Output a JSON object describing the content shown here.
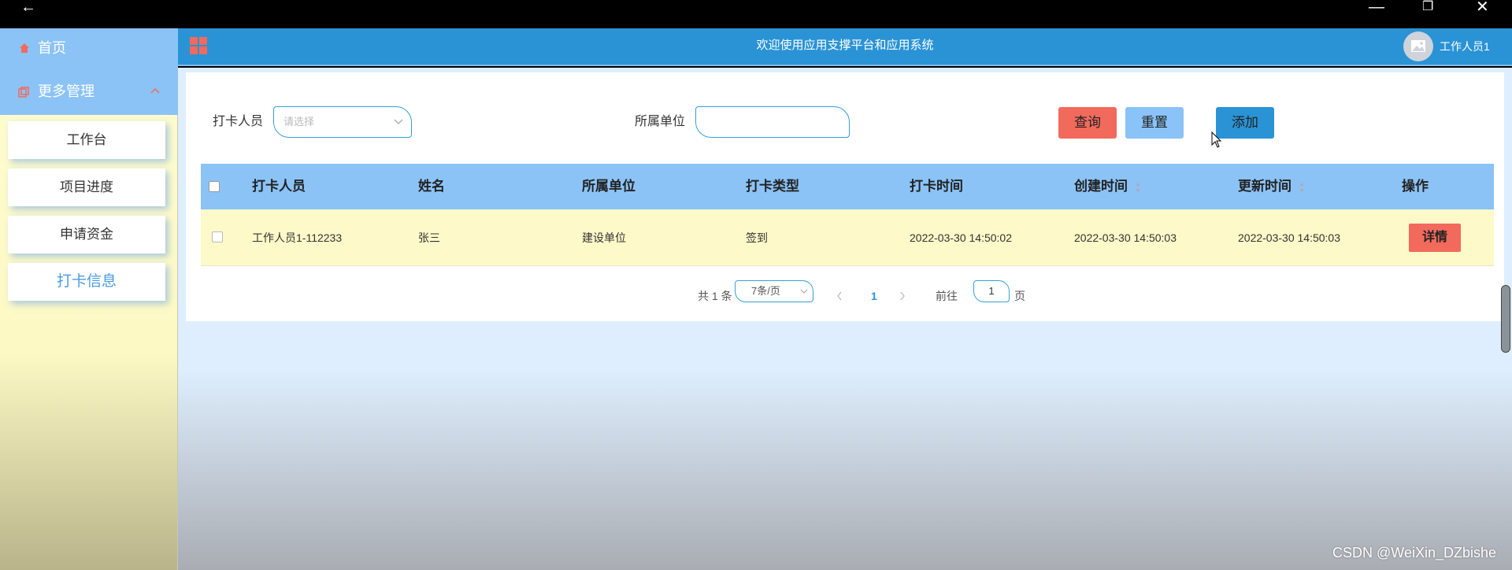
{
  "sidebar": {
    "home_label": "首页",
    "more_label": "更多管理",
    "items": [
      {
        "label": "工作台"
      },
      {
        "label": "项目进度"
      },
      {
        "label": "申请资金"
      },
      {
        "label": "打卡信息",
        "active": true
      }
    ]
  },
  "header": {
    "title": "欢迎使用应用支撑平台和应用系统",
    "user": "工作人员1"
  },
  "filters": {
    "person_label": "打卡人员",
    "person_placeholder": "请选择",
    "unit_label": "所属单位",
    "unit_value": ""
  },
  "buttons": {
    "query": "查询",
    "reset": "重置",
    "add": "添加"
  },
  "table": {
    "headers": [
      "打卡人员",
      "姓名",
      "所属单位",
      "打卡类型",
      "打卡时间",
      "创建时间",
      "更新时间",
      "操作"
    ],
    "rows": [
      [
        "工作人员1-112233",
        "张三",
        "建设单位",
        "签到",
        "2022-03-30 14:50:02",
        "2022-03-30 14:50:03",
        "2022-03-30 14:50:03"
      ]
    ],
    "detail_label": "详情"
  },
  "pagination": {
    "total": "共 1 条",
    "page_size": "7条/页",
    "current": "1",
    "goto_label": "前往",
    "goto_value": "1",
    "page_suffix": "页"
  },
  "watermark": "CSDN @WeiXin_DZbishe",
  "colors": {
    "accent": "#2a93d5",
    "light_blue": "#8bc3f7",
    "danger": "#f26a5c",
    "row_bg": "#fdf9c8"
  }
}
